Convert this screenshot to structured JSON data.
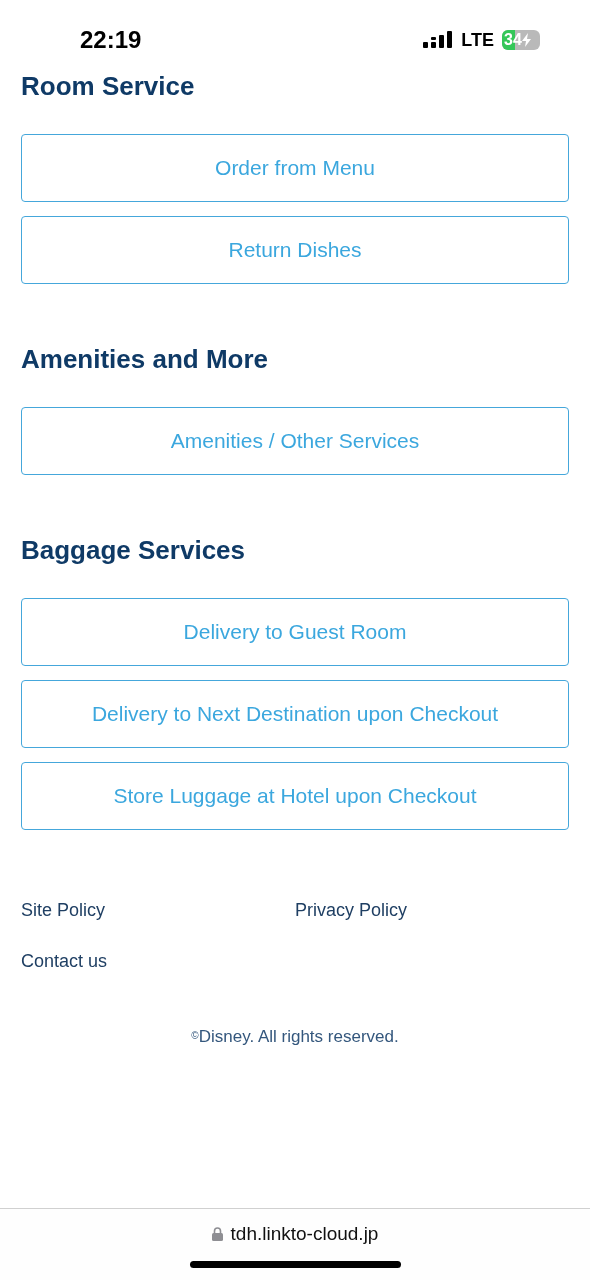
{
  "status_bar": {
    "time": "22:19",
    "network": "LTE",
    "battery": {
      "text": "34",
      "level": 0.34,
      "charging": true
    }
  },
  "sections": [
    {
      "title": "Room Service",
      "buttons": [
        "Order from Menu",
        "Return Dishes"
      ]
    },
    {
      "title": "Amenities and More",
      "buttons": [
        "Amenities / Other Services"
      ]
    },
    {
      "title": "Baggage Services",
      "buttons": [
        "Delivery to Guest Room",
        "Delivery to Next Destination upon Checkout",
        "Store Luggage at Hotel upon Checkout"
      ]
    }
  ],
  "footer": {
    "links": [
      "Site Policy",
      "Privacy Policy",
      "Contact us"
    ],
    "copyright": "$^{©}$Disney. All rights reserved."
  },
  "browser_bar": {
    "url": "tdh.linkto-cloud.jp",
    "secure": true
  }
}
